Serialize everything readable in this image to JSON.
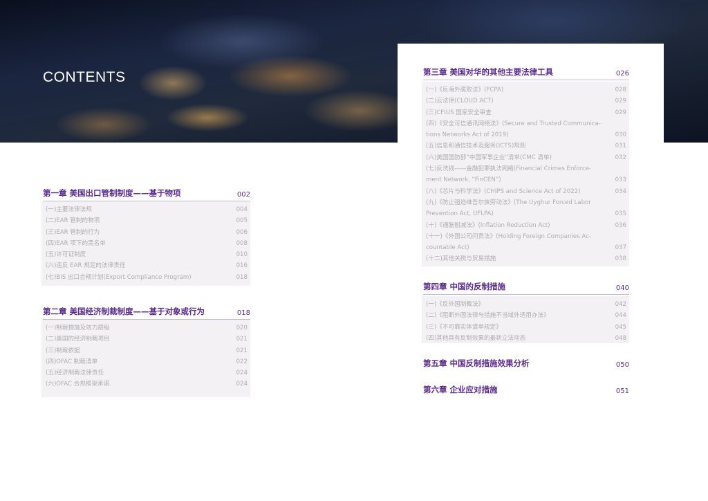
{
  "title": "CONTENTS",
  "chapters": [
    {
      "title": "第一章 美国出口管制制度——基于物项",
      "page": "002",
      "items": [
        [
          "(一)主要法律法规",
          "004"
        ],
        [
          "(二)EAR 管制的物项",
          "005"
        ],
        [
          "(三)EAR 管制的行为",
          "006"
        ],
        [
          "(四)EAR 项下的黑名单",
          "008"
        ],
        [
          "(五)许可证制度",
          "010"
        ],
        [
          "(六)违反 EAR 规定的法律责任",
          "016"
        ],
        [
          "(七)BIS 出口合规计划(Export Compliance Program)",
          "018"
        ]
      ]
    },
    {
      "title": "第二章 美国经济制裁制度——基于对象或行为",
      "page": "018",
      "items": [
        [
          "(一)制裁措施及效力层级",
          "020"
        ],
        [
          "(二)美国的经济制裁项目",
          "021"
        ],
        [
          "(三)制裁依据",
          "021"
        ],
        [
          "(四)OFAC 制裁清单",
          "022"
        ],
        [
          "(五)经济制裁法律责任",
          "024"
        ],
        [
          "(六)OFAC 合规框架承诺",
          "024"
        ]
      ]
    },
    {
      "title": "第三章 美国对华的其他主要法律工具",
      "page": "026",
      "items": [
        [
          "(一)《反海外腐败法》(FCPA)",
          "028"
        ],
        [
          "(二)云法律(CLOUD ACT)",
          "029"
        ],
        [
          "(三)CFIUS 国家安全审查",
          "029"
        ],
        [
          "(四)《安全可信通讯网络法》(Secure and Trusted Communica-",
          ""
        ],
        [
          "tions Networks Act of 2019)",
          "030"
        ],
        [
          "(五)信息和通信技术及服务(ICTS)规则",
          "031"
        ],
        [
          "(六)美国国防部“中国军事企业”清单(CMC 清单)",
          "032"
        ],
        [
          "(七)反洗钱——金融犯罪执法网络(Financial Crimes Enforce-",
          ""
        ],
        [
          "ment Network, “FinCEN”)",
          "033"
        ],
        [
          "(八)《芯片与科学法》(CHIPS and Science Act of 2022)",
          "034"
        ],
        [
          "(九)《防止强迫维吾尔族劳动法》(The Uyghur Forced Labor",
          ""
        ],
        [
          "Prevention Act, UFLPA)",
          "035"
        ],
        [
          "(十)《通胀削减法》(Inflation Reduction Act)",
          "036"
        ],
        [
          "(十一)《外国公司问责法》(Holding Foreign Companies Ac-",
          ""
        ],
        [
          "countable Act)",
          "037"
        ],
        [
          "(十二)其他关税与贸易措施",
          "038"
        ]
      ]
    },
    {
      "title": "第四章 中国的反制措施",
      "page": "040",
      "items": [
        [
          "(一)《反外国制裁法》",
          "042"
        ],
        [
          "(二)《阻断外国法律与措施不当域外适用办法》",
          "044"
        ],
        [
          "(三)《不可靠实体清单规定》",
          "045"
        ],
        [
          "(四)其他具有反制效果的最新立法动态",
          "048"
        ]
      ]
    },
    {
      "title": "第五章 中国反制措施效果分析",
      "page": "050",
      "items": []
    },
    {
      "title": "第六章 企业应对措施",
      "page": "051",
      "items": []
    }
  ]
}
